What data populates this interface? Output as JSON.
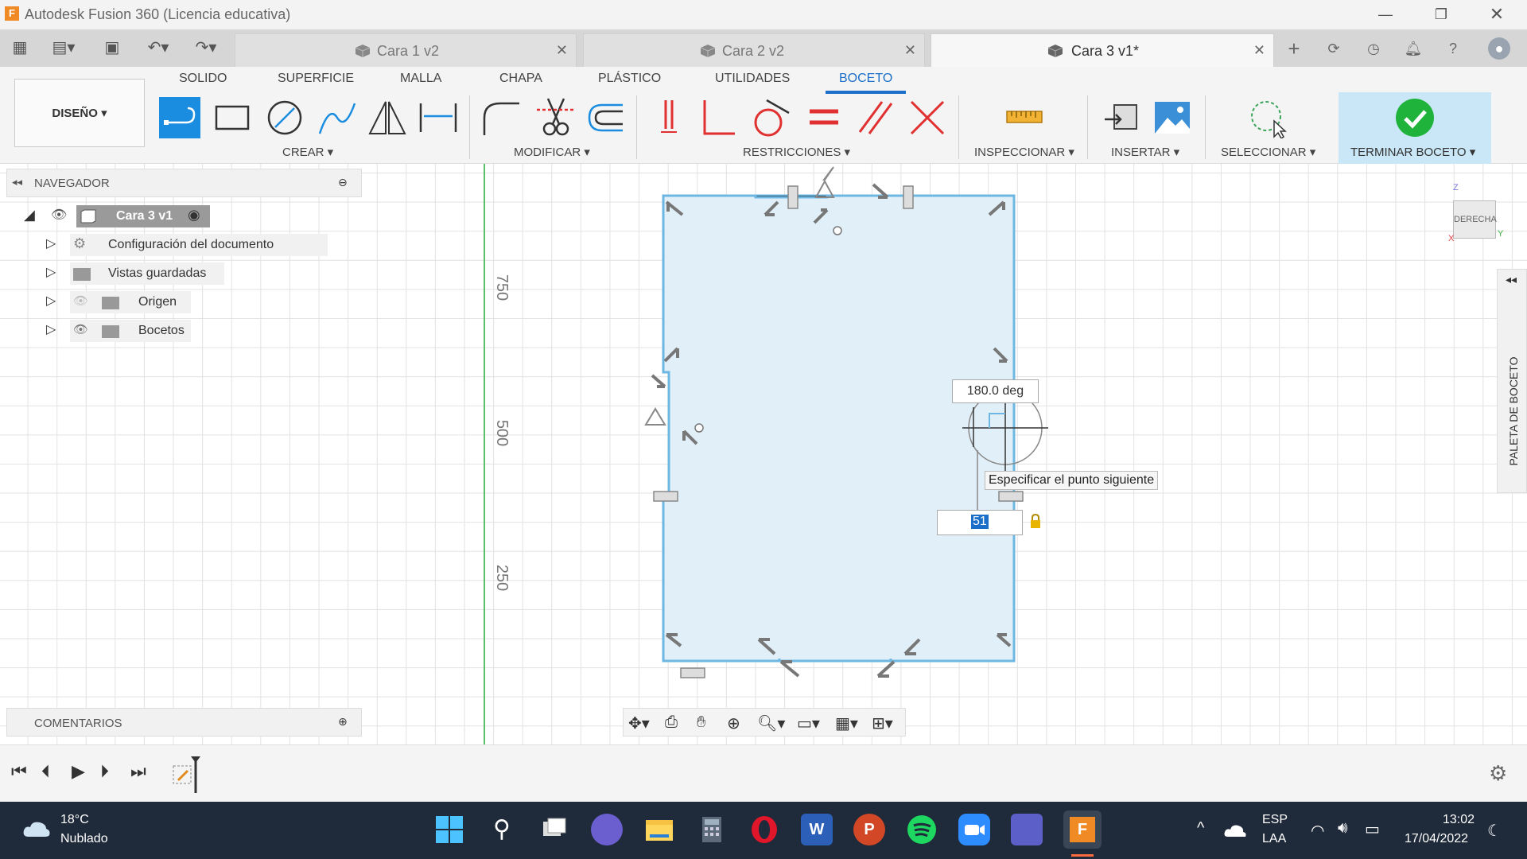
{
  "window": {
    "title": "Autodesk Fusion 360 (Licencia educativa)",
    "logo_letter": "F"
  },
  "tabs": [
    {
      "label": "Cara 1 v2",
      "active": false
    },
    {
      "label": "Cara 2 v2",
      "active": false
    },
    {
      "label": "Cara 3 v1*",
      "active": true
    }
  ],
  "ribbon": {
    "workspace_button": "DISEÑO ▾",
    "tabs": [
      "SOLIDO",
      "SUPERFICIE",
      "MALLA",
      "CHAPA",
      "PLÁSTICO",
      "UTILIDADES",
      "BOCETO"
    ],
    "active_tab": "BOCETO",
    "groups": {
      "crear": "CREAR ▾",
      "modificar": "MODIFICAR ▾",
      "restricciones": "RESTRICCIONES ▾",
      "inspeccionar": "INSPECCIONAR ▾",
      "insertar": "INSERTAR ▾",
      "seleccionar": "SELECCIONAR ▾",
      "terminar": "TERMINAR BOCETO ▾"
    }
  },
  "navigator": {
    "title": "NAVEGADOR",
    "root": "Cara 3 v1",
    "items": [
      "Configuración del documento",
      "Vistas guardadas",
      "Origen",
      "Bocetos"
    ]
  },
  "comments": {
    "title": "COMENTARIOS"
  },
  "canvas": {
    "ruler_labels": [
      "750",
      "500",
      "250"
    ],
    "angle_readout": "180.0 deg",
    "tooltip": "Especificar el punto siguiente",
    "length_input": "51",
    "viewcube_label": "DERECHA",
    "viewcube_axes": {
      "z": "Z",
      "x": "X",
      "y": "Y"
    },
    "sketch_palette": "PALETA DE BOCETO"
  },
  "taskbar": {
    "weather_temp": "18°C",
    "weather_desc": "Nublado",
    "lang": "ESP",
    "layout": "LAA",
    "time": "13:02",
    "date": "17/04/2022",
    "word_letter": "W",
    "ppt_letter": "P",
    "fusion_letter": "F"
  },
  "colors": {
    "accent": "#1b6fc8",
    "sketch_fill": "#e1eff8",
    "sketch_line": "#6fb7e3",
    "finish_bg": "#c9e7f7",
    "taskbar": "#1f2a3a"
  }
}
